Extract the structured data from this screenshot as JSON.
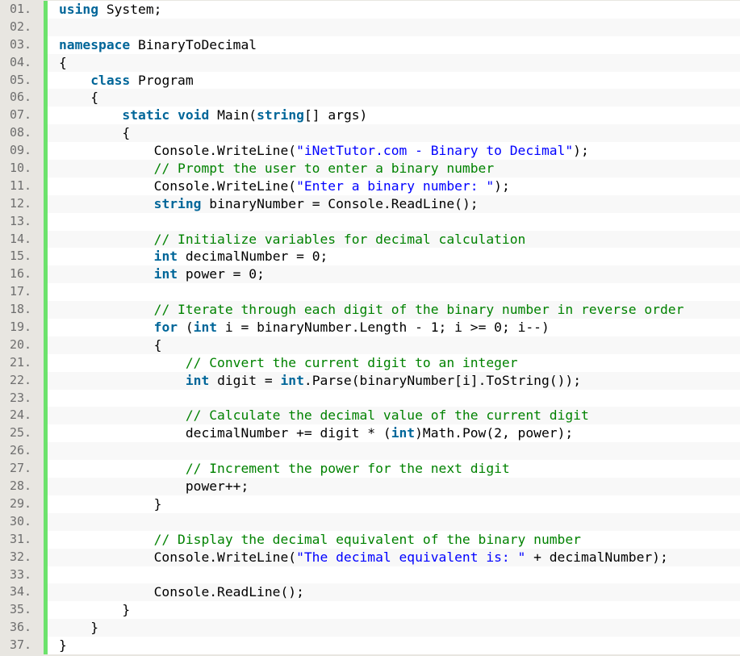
{
  "colors": {
    "keyword": "#006699",
    "string": "#0000ff",
    "comment": "#008200",
    "plain": "#000000",
    "gutter_bar": "#6ce26c"
  },
  "language": "C#",
  "lines": [
    {
      "num": "01.",
      "tokens": [
        [
          "kw",
          "using"
        ],
        [
          "pl",
          " System;"
        ]
      ]
    },
    {
      "num": "02.",
      "tokens": []
    },
    {
      "num": "03.",
      "tokens": [
        [
          "kw",
          "namespace"
        ],
        [
          "pl",
          " BinaryToDecimal"
        ]
      ]
    },
    {
      "num": "04.",
      "tokens": [
        [
          "pl",
          "{"
        ]
      ]
    },
    {
      "num": "05.",
      "tokens": [
        [
          "pl",
          "    "
        ],
        [
          "kw",
          "class"
        ],
        [
          "pl",
          " Program"
        ]
      ]
    },
    {
      "num": "06.",
      "tokens": [
        [
          "pl",
          "    {"
        ]
      ]
    },
    {
      "num": "07.",
      "tokens": [
        [
          "pl",
          "        "
        ],
        [
          "kw",
          "static"
        ],
        [
          "pl",
          " "
        ],
        [
          "kw",
          "void"
        ],
        [
          "pl",
          " Main("
        ],
        [
          "kw",
          "string"
        ],
        [
          "pl",
          "[] args)"
        ]
      ]
    },
    {
      "num": "08.",
      "tokens": [
        [
          "pl",
          "        {"
        ]
      ]
    },
    {
      "num": "09.",
      "tokens": [
        [
          "pl",
          "            Console.WriteLine("
        ],
        [
          "str",
          "\"iNetTutor.com - Binary to Decimal\""
        ],
        [
          "pl",
          ");"
        ]
      ]
    },
    {
      "num": "10.",
      "tokens": [
        [
          "pl",
          "            "
        ],
        [
          "cm",
          "// Prompt the user to enter a binary number"
        ]
      ]
    },
    {
      "num": "11.",
      "tokens": [
        [
          "pl",
          "            Console.WriteLine("
        ],
        [
          "str",
          "\"Enter a binary number: \""
        ],
        [
          "pl",
          ");"
        ]
      ]
    },
    {
      "num": "12.",
      "tokens": [
        [
          "pl",
          "            "
        ],
        [
          "kw",
          "string"
        ],
        [
          "pl",
          " binaryNumber = Console.ReadLine();"
        ]
      ]
    },
    {
      "num": "13.",
      "tokens": []
    },
    {
      "num": "14.",
      "tokens": [
        [
          "pl",
          "            "
        ],
        [
          "cm",
          "// Initialize variables for decimal calculation"
        ]
      ]
    },
    {
      "num": "15.",
      "tokens": [
        [
          "pl",
          "            "
        ],
        [
          "kw",
          "int"
        ],
        [
          "pl",
          " decimalNumber = 0;"
        ]
      ]
    },
    {
      "num": "16.",
      "tokens": [
        [
          "pl",
          "            "
        ],
        [
          "kw",
          "int"
        ],
        [
          "pl",
          " power = 0;"
        ]
      ]
    },
    {
      "num": "17.",
      "tokens": []
    },
    {
      "num": "18.",
      "tokens": [
        [
          "pl",
          "            "
        ],
        [
          "cm",
          "// Iterate through each digit of the binary number in reverse order"
        ]
      ]
    },
    {
      "num": "19.",
      "tokens": [
        [
          "pl",
          "            "
        ],
        [
          "kw",
          "for"
        ],
        [
          "pl",
          " ("
        ],
        [
          "kw",
          "int"
        ],
        [
          "pl",
          " i = binaryNumber.Length - 1; i >= 0; i--)"
        ]
      ]
    },
    {
      "num": "20.",
      "tokens": [
        [
          "pl",
          "            {"
        ]
      ]
    },
    {
      "num": "21.",
      "tokens": [
        [
          "pl",
          "                "
        ],
        [
          "cm",
          "// Convert the current digit to an integer"
        ]
      ]
    },
    {
      "num": "22.",
      "tokens": [
        [
          "pl",
          "                "
        ],
        [
          "kw",
          "int"
        ],
        [
          "pl",
          " digit = "
        ],
        [
          "kw",
          "int"
        ],
        [
          "pl",
          ".Parse(binaryNumber[i].ToString());"
        ]
      ]
    },
    {
      "num": "23.",
      "tokens": []
    },
    {
      "num": "24.",
      "tokens": [
        [
          "pl",
          "                "
        ],
        [
          "cm",
          "// Calculate the decimal value of the current digit"
        ]
      ]
    },
    {
      "num": "25.",
      "tokens": [
        [
          "pl",
          "                decimalNumber += digit * ("
        ],
        [
          "kw",
          "int"
        ],
        [
          "pl",
          ")Math.Pow(2, power);"
        ]
      ]
    },
    {
      "num": "26.",
      "tokens": []
    },
    {
      "num": "27.",
      "tokens": [
        [
          "pl",
          "                "
        ],
        [
          "cm",
          "// Increment the power for the next digit"
        ]
      ]
    },
    {
      "num": "28.",
      "tokens": [
        [
          "pl",
          "                power++;"
        ]
      ]
    },
    {
      "num": "29.",
      "tokens": [
        [
          "pl",
          "            }"
        ]
      ]
    },
    {
      "num": "30.",
      "tokens": []
    },
    {
      "num": "31.",
      "tokens": [
        [
          "pl",
          "            "
        ],
        [
          "cm",
          "// Display the decimal equivalent of the binary number"
        ]
      ]
    },
    {
      "num": "32.",
      "tokens": [
        [
          "pl",
          "            Console.WriteLine("
        ],
        [
          "str",
          "\"The decimal equivalent is: \""
        ],
        [
          "pl",
          " + decimalNumber);"
        ]
      ]
    },
    {
      "num": "33.",
      "tokens": []
    },
    {
      "num": "34.",
      "tokens": [
        [
          "pl",
          "            Console.ReadLine();"
        ]
      ]
    },
    {
      "num": "35.",
      "tokens": [
        [
          "pl",
          "        }"
        ]
      ]
    },
    {
      "num": "36.",
      "tokens": [
        [
          "pl",
          "    }"
        ]
      ]
    },
    {
      "num": "37.",
      "tokens": [
        [
          "pl",
          "}"
        ]
      ]
    }
  ]
}
